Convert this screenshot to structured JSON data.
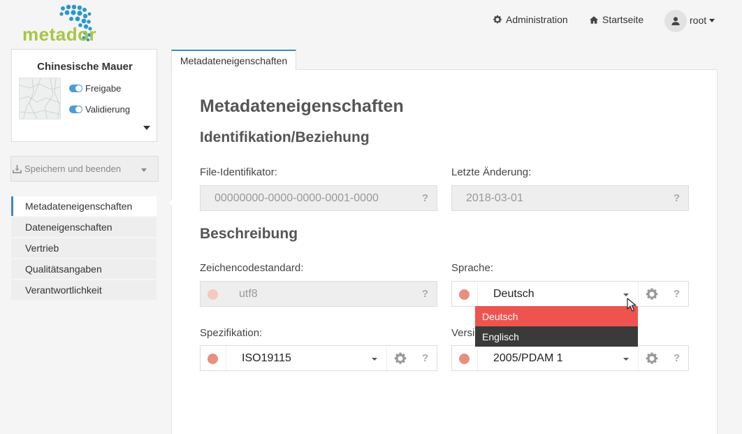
{
  "header": {
    "logo_text": "metador",
    "nav_admin": "Administration",
    "nav_home": "Startseite",
    "user_name": "root"
  },
  "card": {
    "title": "Chinesische Mauer",
    "toggle_release": "Freigabe",
    "toggle_validation": "Validierung"
  },
  "save_button": {
    "label": "Speichern und beenden"
  },
  "sidenav": {
    "items": [
      {
        "label": "Metadateneigenschaften",
        "active": true
      },
      {
        "label": "Dateneigenschaften",
        "active": false
      },
      {
        "label": "Vertrieb",
        "active": false
      },
      {
        "label": "Qualitätsangaben",
        "active": false
      },
      {
        "label": "Verantwortlichkeit",
        "active": false
      }
    ]
  },
  "tab": {
    "label": "Metadateneigenschaften"
  },
  "form": {
    "heading": "Metadateneigenschaften",
    "section_identification": "Identifikation/Beziehung",
    "file_id_label": "File-Identifikator:",
    "file_id_value": "00000000-0000-0000-0001-0000",
    "last_change_label": "Letzte Änderung:",
    "last_change_value": "2018-03-01",
    "section_description": "Beschreibung",
    "charset_label": "Zeichencodestandard:",
    "charset_value": "utf8",
    "language_label": "Sprache:",
    "language_value": "Deutsch",
    "spec_label": "Spezifikation:",
    "spec_value": "ISO19115",
    "version_label": "Versi",
    "version_value": "2005/PDAM 1",
    "help_mark": "?"
  },
  "language_menu": {
    "options": [
      "Deutsch",
      "Englisch"
    ],
    "selected": "Deutsch"
  },
  "colors": {
    "accent": "#3b87c8",
    "logo_green": "#a8c545",
    "logo_blue": "#2a98c9",
    "status_dot": "#e8907c",
    "menu_selected": "#ef5350",
    "menu_dark": "#3a3a3a"
  }
}
